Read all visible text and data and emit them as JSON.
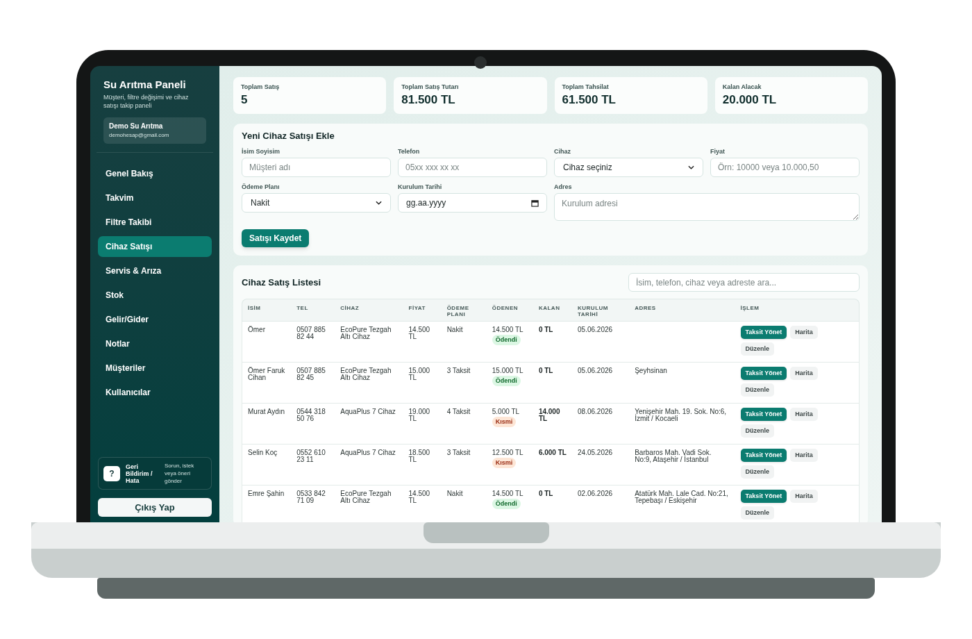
{
  "sidebar": {
    "title": "Su Arıtma Paneli",
    "subtitle": "Müşteri, filtre değişimi ve cihaz satışı takip paneli",
    "account": {
      "name": "Demo Su Arıtma",
      "email": "demohesap@gmail.com"
    },
    "items": [
      {
        "label": "Genel Bakış",
        "selected": false
      },
      {
        "label": "Takvim",
        "selected": false
      },
      {
        "label": "Filtre Takibi",
        "selected": false
      },
      {
        "label": "Cihaz Satışı",
        "selected": true
      },
      {
        "label": "Servis & Arıza",
        "selected": false
      },
      {
        "label": "Stok",
        "selected": false
      },
      {
        "label": "Gelir/Gider",
        "selected": false
      },
      {
        "label": "Notlar",
        "selected": false
      },
      {
        "label": "Müşteriler",
        "selected": false
      },
      {
        "label": "Kullanıcılar",
        "selected": false
      }
    ],
    "feedback": {
      "icon": "?",
      "title": "Geri Bildirim / Hata",
      "text": "Sorun, istek veya öneri gönder"
    },
    "logout": "Çıkış Yap"
  },
  "stats": [
    {
      "label": "Toplam Satış",
      "value": "5"
    },
    {
      "label": "Toplam Satış Tutarı",
      "value": "81.500 TL"
    },
    {
      "label": "Toplam Tahsilat",
      "value": "61.500 TL"
    },
    {
      "label": "Kalan Alacak",
      "value": "20.000 TL"
    }
  ],
  "form": {
    "title": "Yeni Cihaz Satışı Ekle",
    "fields": [
      {
        "label": "İsim Soyisim",
        "kind": "text",
        "placeholder": "Müşteri adı"
      },
      {
        "label": "Telefon",
        "kind": "text",
        "placeholder": "05xx xxx xx xx"
      },
      {
        "label": "Cihaz",
        "kind": "select",
        "value": "Cihaz seçiniz"
      },
      {
        "label": "Fiyat",
        "kind": "text",
        "placeholder": "Örn: 10000 veya 10.000,50"
      },
      {
        "label": "Ödeme Planı",
        "kind": "select",
        "value": "Nakit"
      },
      {
        "label": "Kurulum Tarihi",
        "kind": "date",
        "placeholder": "gg.aa.yyyy"
      },
      {
        "label": "Adres",
        "kind": "textarea",
        "placeholder": "Kurulum adresi"
      }
    ],
    "submit": "Satışı Kaydet"
  },
  "list": {
    "title": "Cihaz Satış Listesi",
    "search": {
      "placeholder": "İsim, telefon, cihaz veya adreste ara..."
    },
    "columns": [
      "İSİM",
      "TEL",
      "CİHAZ",
      "FİYAT",
      "ÖDEME PLANI",
      "ÖDENEN",
      "KALAN",
      "KURULUM TARİHİ",
      "ADRES",
      "İŞLEM"
    ],
    "rows": [
      {
        "name": "Ömer",
        "phone": "0507 885 82 44",
        "device": "EcoPure Tezgah Altı Cihaz",
        "price": "14.500 TL",
        "plan": "Nakit",
        "paid": "14.500 TL",
        "status": {
          "label": "Ödendi",
          "kind": "paid"
        },
        "remaining": "0 TL",
        "date": "05.06.2026",
        "actions": [
          "Taksit Yönet",
          "Harita",
          "Düzenle"
        ]
      },
      {
        "name": "Ömer Faruk Cihan",
        "phone": "0507 885 82 45",
        "device": "EcoPure Tezgah Altı Cihaz",
        "price": "15.000 TL",
        "plan": "3 Taksit",
        "paid": "15.000 TL",
        "status": {
          "label": "Ödendi",
          "kind": "paid"
        },
        "remaining": "0 TL",
        "date": "05.06.2026",
        "address": "Şeyhsinan",
        "actions": [
          "Taksit Yönet",
          "Harita",
          "Düzenle"
        ]
      },
      {
        "name": "Murat Aydın",
        "phone": "0544 318 50 76",
        "device": "AquaPlus 7 Cihaz",
        "price": "19.000 TL",
        "plan": "4 Taksit",
        "paid": "5.000 TL",
        "status": {
          "label": "Kısmi",
          "kind": "partial"
        },
        "remaining": "14.000 TL",
        "date": "08.06.2026",
        "address": "Yenişehir Mah. 19. Sok. No:6, İzmit / Kocaeli",
        "actions": [
          "Taksit Yönet",
          "Harita",
          "Düzenle"
        ]
      },
      {
        "name": "Selin Koç",
        "phone": "0552 610 23 11",
        "device": "AquaPlus 7 Cihaz",
        "price": "18.500 TL",
        "plan": "3 Taksit",
        "paid": "12.500 TL",
        "status": {
          "label": "Kısmi",
          "kind": "partial"
        },
        "remaining": "6.000 TL",
        "date": "24.05.2026",
        "address": "Barbaros Mah. Vadi Sok. No:9, Ataşehir / İstanbul",
        "actions": [
          "Taksit Yönet",
          "Harita",
          "Düzenle"
        ]
      },
      {
        "name": "Emre Şahin",
        "phone": "0533 842 71 09",
        "device": "EcoPure Tezgah Altı Cihaz",
        "price": "14.500 TL",
        "plan": "Nakit",
        "paid": "14.500 TL",
        "status": {
          "label": "Ödendi",
          "kind": "paid"
        },
        "remaining": "0 TL",
        "date": "02.06.2026",
        "address": "Atatürk Mah. Lale Cad. No:21, Tepebaşı / Eskişehir",
        "actions": [
          "Taksit Yönet",
          "Harita",
          "Düzenle"
        ]
      }
    ]
  }
}
